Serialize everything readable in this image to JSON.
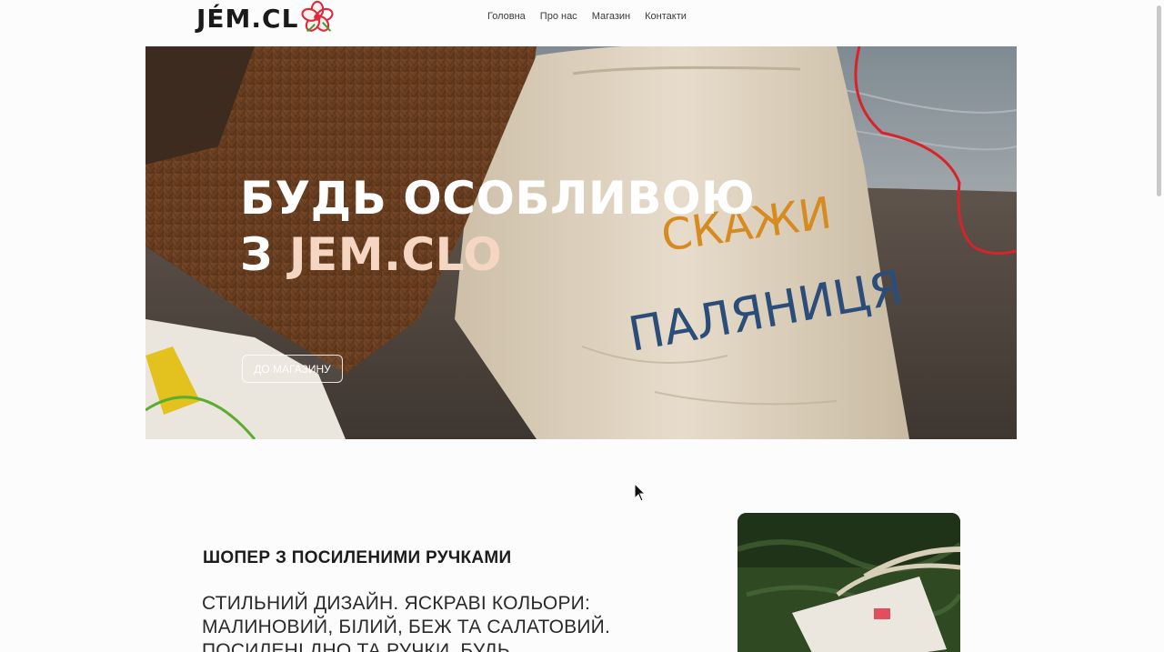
{
  "header": {
    "logo_text": "JÉM.CL",
    "nav": [
      {
        "label": "Головна"
      },
      {
        "label": "Про нас"
      },
      {
        "label": "Магазин"
      },
      {
        "label": "Контакти"
      }
    ]
  },
  "hero": {
    "title_line1": "БУДЬ ОСОБЛИВОЮ",
    "title_line2_prefix": "З ",
    "title_line2_accent": "JEM.CLO",
    "button_label": "ДО МАГАЗИНУ",
    "bag_text_1": "СКАЖИ",
    "bag_text_2": "ПАЛЯНИЦЯ"
  },
  "product": {
    "title": "ШОПЕР З ПОСИЛЕНИМИ РУЧКАМИ",
    "description": "СТИЛЬНИЙ ДИЗАЙН. ЯСКРАВІ КОЛЬОРИ: МАЛИНОВИЙ, БІЛИЙ, БЕЖ ТА САЛАТОВИЙ. ПОСИЛЕНІ ДНО ТА РУЧКИ. БУДЬ"
  },
  "colors": {
    "accent": "#f4d6c2",
    "logo_flower_red": "#e0283a",
    "hero_red_line": "#d8232a",
    "hero_green_line": "#5aae2e"
  }
}
